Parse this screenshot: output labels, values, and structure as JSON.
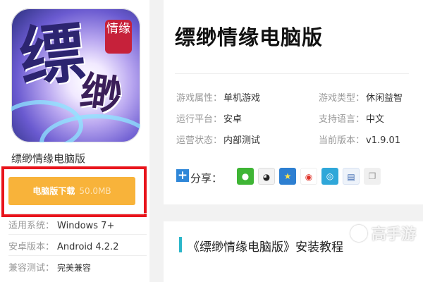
{
  "app": {
    "name": "缥缈情缘电脑版",
    "icon_text_large": "缥",
    "icon_text_small": "缈",
    "icon_seal_text": "情缘"
  },
  "download": {
    "label": "电脑版下载",
    "size": "50.0MB"
  },
  "specs": [
    {
      "label": "适用系统：",
      "value": "Windows 7+"
    },
    {
      "label": "安卓版本：",
      "value": "Android 4.2.2"
    },
    {
      "label": "兼容测试：",
      "value": "完美兼容"
    }
  ],
  "detail": {
    "title": "缥缈情缘电脑版",
    "attributes": [
      {
        "label": "游戏属性：",
        "value": "单机游戏"
      },
      {
        "label": "游戏类型：",
        "value": "休闲益智"
      },
      {
        "label": "运行平台：",
        "value": "安卓"
      },
      {
        "label": "支持语言：",
        "value": "中文"
      },
      {
        "label": "运营状态：",
        "value": "内部测试"
      },
      {
        "label": "当前版本：",
        "value": "v1.9.01"
      }
    ],
    "share_label": "分享："
  },
  "share_icons": [
    "wechat-icon",
    "qq-icon",
    "qzone-icon",
    "weibo-icon",
    "tencent-weibo-icon",
    "print-icon",
    "copy-icon"
  ],
  "tutorial": {
    "title": "《缥缈情缘电脑版》安装教程"
  },
  "watermark": {
    "text": "高手游"
  },
  "colors": {
    "download_button": "#f8b33a",
    "highlight_frame": "#e8141b",
    "accent_bar": "#2bb6c9"
  }
}
